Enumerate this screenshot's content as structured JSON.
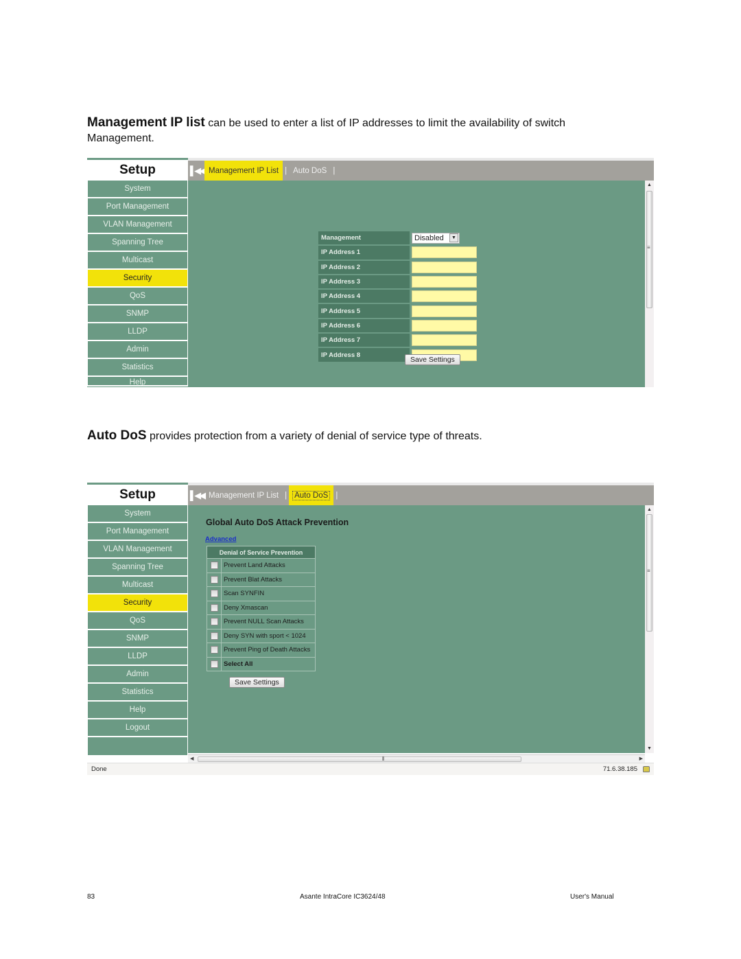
{
  "intro1": {
    "bold": "Management IP list",
    "text": " can be used to enter a list of IP addresses to limit the availability of switch Management."
  },
  "intro2": {
    "bold": "Auto DoS",
    "text": " provides protection from a variety of denial of service type of threats."
  },
  "sidebar": {
    "title": "Setup",
    "items": [
      "System",
      "Port Management",
      "VLAN Management",
      "Spanning Tree",
      "Multicast",
      "Security",
      "QoS",
      "SNMP",
      "LLDP",
      "Admin",
      "Statistics",
      "Help",
      "Logout"
    ],
    "active": "Security"
  },
  "tabs": [
    "Management IP List",
    "Auto DoS"
  ],
  "mgmt_ip_list": {
    "management_label": "Management",
    "management_value": "Disabled",
    "ip_labels": [
      "IP Address 1",
      "IP Address 2",
      "IP Address 3",
      "IP Address 4",
      "IP Address 5",
      "IP Address 6",
      "IP Address 7",
      "IP Address 8"
    ],
    "ip_values": [
      "",
      "",
      "",
      "",
      "",
      "",
      "",
      ""
    ],
    "save_label": "Save Settings"
  },
  "auto_dos": {
    "title": "Global Auto DoS Attack Prevention",
    "advanced_link": "Advanced",
    "table_header": "Denial of Service Prevention",
    "options": [
      {
        "label": "Prevent Land Attacks",
        "checked": false
      },
      {
        "label": "Prevent Blat Attacks",
        "checked": false
      },
      {
        "label": "Scan SYNFIN",
        "checked": false
      },
      {
        "label": "Deny Xmascan",
        "checked": false
      },
      {
        "label": "Prevent NULL Scan Attacks",
        "checked": false
      },
      {
        "label": "Deny SYN with sport < 1024",
        "checked": false
      },
      {
        "label": "Prevent Ping of Death Attacks",
        "checked": false
      }
    ],
    "select_all_label": "Select All",
    "save_label": "Save Settings"
  },
  "browser_status": {
    "status_text": "Done",
    "ip_address": "71.6.38.185"
  },
  "footer": {
    "page_number": "83",
    "product": "Asante IntraCore IC3624/48",
    "manual": "User's Manual"
  },
  "colors": {
    "panel_green": "#6b9a84",
    "label_dark_green": "#4c7a64",
    "highlight_yellow": "#f2e20a",
    "input_yellow": "#fffaa6",
    "tabbar_gray": "#a3a19c"
  }
}
